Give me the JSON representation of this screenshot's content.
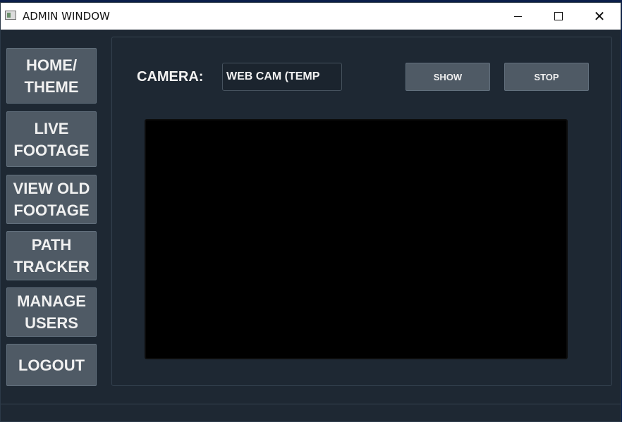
{
  "window": {
    "title": "ADMIN WINDOW"
  },
  "sidebar": {
    "items": [
      {
        "label": "HOME/\nTHEME"
      },
      {
        "label": "LIVE\nFOOTAGE"
      },
      {
        "label": "VIEW OLD\nFOOTAGE"
      },
      {
        "label": "PATH\nTRACKER"
      },
      {
        "label": "MANAGE\nUSERS"
      },
      {
        "label": "LOGOUT"
      }
    ]
  },
  "camera": {
    "label": "CAMERA:",
    "selected": "WEB CAM (TEMP"
  },
  "actions": {
    "show_label": "SHOW",
    "stop_label": "STOP"
  },
  "colors": {
    "background": "#1e2833",
    "button": "#4f5a65",
    "text": "#f0f0f0",
    "video": "#000000"
  }
}
